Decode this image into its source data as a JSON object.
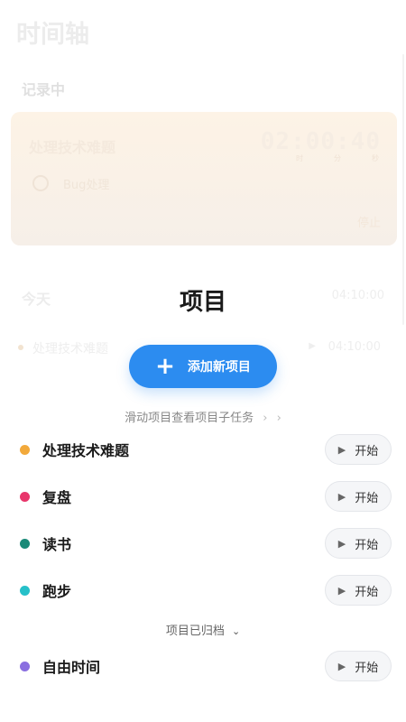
{
  "background": {
    "title": "时间轴",
    "recording_label": "记录中",
    "card": {
      "title": "处理技术难题",
      "timer": "02:00:40",
      "timer_units": [
        "时",
        "分",
        "秒"
      ],
      "task": "Bug处理",
      "stop_label": "停止"
    },
    "today": {
      "label": "今天",
      "total": "04:10:00"
    },
    "row": {
      "label": "处理技术难题",
      "time": "04:10:00"
    }
  },
  "sheet": {
    "title": "项目",
    "add_button_label": "添加新项目",
    "hint": "滑动项目查看项目子任务",
    "archived_label": "项目已归档",
    "start_label": "开始",
    "projects": [
      {
        "name": "处理技术难题",
        "color": "#f2a93b"
      },
      {
        "name": "复盘",
        "color": "#e8366b"
      },
      {
        "name": "读书",
        "color": "#1a8a78"
      },
      {
        "name": "跑步",
        "color": "#26c0c9"
      }
    ],
    "archived_projects": [
      {
        "name": "自由时间",
        "color": "#8a6fe0"
      }
    ]
  }
}
